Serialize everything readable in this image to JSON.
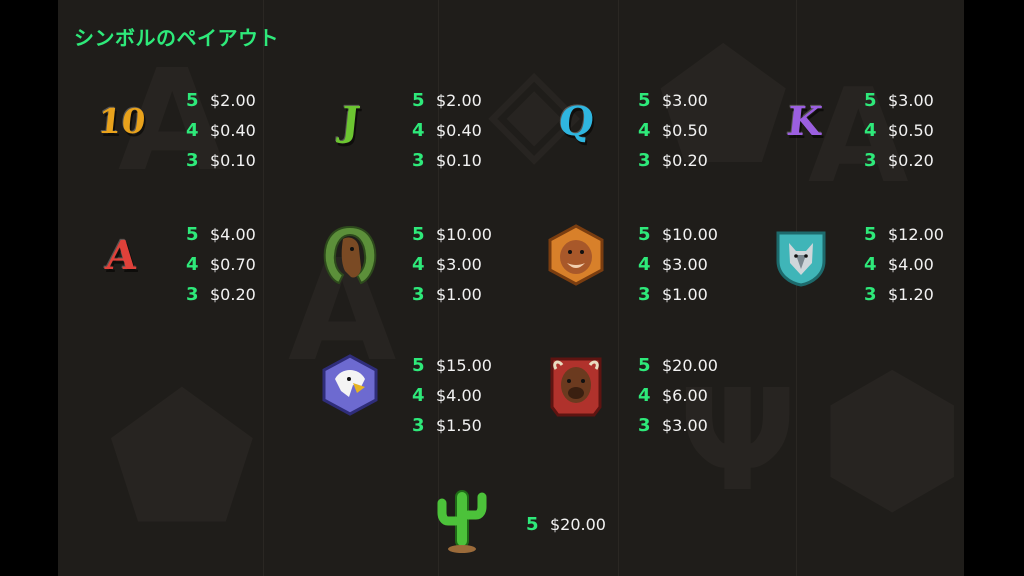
{
  "title": "シンボルのペイアウト",
  "symbols": [
    {
      "name": "10",
      "icon": "ten-letter",
      "color": "#e8a21c",
      "pays": [
        {
          "count": "5",
          "amount": "$2.00"
        },
        {
          "count": "4",
          "amount": "$0.40"
        },
        {
          "count": "3",
          "amount": "$0.10"
        }
      ]
    },
    {
      "name": "J",
      "icon": "j-letter",
      "color": "#6cc531",
      "pays": [
        {
          "count": "5",
          "amount": "$2.00"
        },
        {
          "count": "4",
          "amount": "$0.40"
        },
        {
          "count": "3",
          "amount": "$0.10"
        }
      ]
    },
    {
      "name": "Q",
      "icon": "q-letter",
      "color": "#2fb6e0",
      "pays": [
        {
          "count": "5",
          "amount": "$3.00"
        },
        {
          "count": "4",
          "amount": "$0.50"
        },
        {
          "count": "3",
          "amount": "$0.20"
        }
      ]
    },
    {
      "name": "K",
      "icon": "k-letter",
      "color": "#9b5fe0",
      "pays": [
        {
          "count": "5",
          "amount": "$3.00"
        },
        {
          "count": "4",
          "amount": "$0.50"
        },
        {
          "count": "3",
          "amount": "$0.20"
        }
      ]
    },
    {
      "name": "A",
      "icon": "a-letter",
      "color": "#e0413a",
      "pays": [
        {
          "count": "5",
          "amount": "$4.00"
        },
        {
          "count": "4",
          "amount": "$0.70"
        },
        {
          "count": "3",
          "amount": "$0.20"
        }
      ]
    },
    {
      "name": "horse",
      "icon": "horse-horseshoe-icon",
      "color": "#8a5a2b",
      "pays": [
        {
          "count": "5",
          "amount": "$10.00"
        },
        {
          "count": "4",
          "amount": "$3.00"
        },
        {
          "count": "3",
          "amount": "$1.00"
        }
      ]
    },
    {
      "name": "cougar",
      "icon": "cougar-hexagon-icon",
      "color": "#d8802a",
      "pays": [
        {
          "count": "5",
          "amount": "$10.00"
        },
        {
          "count": "4",
          "amount": "$3.00"
        },
        {
          "count": "3",
          "amount": "$1.00"
        }
      ]
    },
    {
      "name": "wolf",
      "icon": "wolf-shield-icon",
      "color": "#3fb5b8",
      "pays": [
        {
          "count": "5",
          "amount": "$12.00"
        },
        {
          "count": "4",
          "amount": "$4.00"
        },
        {
          "count": "3",
          "amount": "$1.20"
        }
      ]
    },
    {
      "name": "eagle",
      "icon": "eagle-hexagon-icon",
      "color": "#6d6ad0",
      "pays": [
        {
          "count": "5",
          "amount": "$15.00"
        },
        {
          "count": "4",
          "amount": "$4.00"
        },
        {
          "count": "3",
          "amount": "$1.50"
        }
      ]
    },
    {
      "name": "bison",
      "icon": "bison-tile-icon",
      "color": "#b0322c",
      "pays": [
        {
          "count": "5",
          "amount": "$20.00"
        },
        {
          "count": "4",
          "amount": "$6.00"
        },
        {
          "count": "3",
          "amount": "$3.00"
        }
      ]
    },
    {
      "name": "cactus",
      "icon": "cactus-icon",
      "color": "#4cc23a",
      "pays": [
        {
          "count": "5",
          "amount": "$20.00"
        }
      ]
    }
  ]
}
